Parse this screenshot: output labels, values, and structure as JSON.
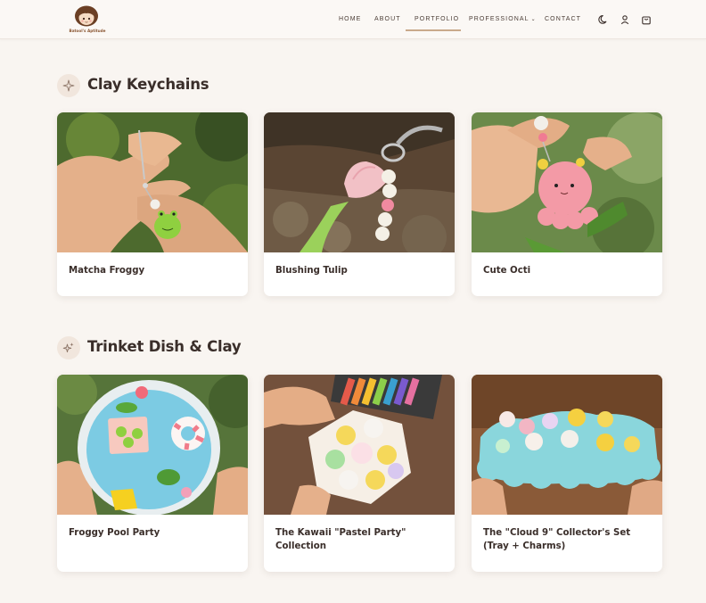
{
  "brand": {
    "logo_text": "Batool's Aptitude"
  },
  "nav": {
    "items": [
      {
        "label": "HOME"
      },
      {
        "label": "ABOUT"
      },
      {
        "label": "PORTFOLIO"
      },
      {
        "label": "PROFESSIONAL"
      },
      {
        "label": "CONTACT"
      }
    ],
    "active": "PORTFOLIO"
  },
  "header_icons": [
    "moon-icon",
    "user-icon",
    "shopping-bag-icon"
  ],
  "sections": [
    {
      "title": "Clay Keychains",
      "icon": "sparkle-icon",
      "items": [
        {
          "title": "Matcha Froggy"
        },
        {
          "title": "Blushing Tulip"
        },
        {
          "title": "Cute Octi"
        }
      ]
    },
    {
      "title": "Trinket Dish & Clay",
      "icon": "sparkles-icon",
      "items": [
        {
          "title": "Froggy Pool Party"
        },
        {
          "title": "The Kawaii \"Pastel Party\" Collection"
        },
        {
          "title": "The \"Cloud 9\" Collector's Set (Tray + Charms)"
        }
      ]
    }
  ],
  "colors": {
    "background": "#f9f5f1",
    "accent": "#c9a98b",
    "text": "#3a2e2a",
    "card": "#ffffff"
  }
}
